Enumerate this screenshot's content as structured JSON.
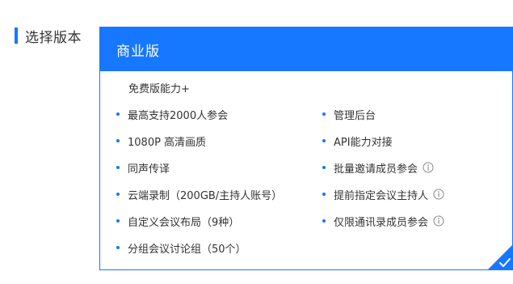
{
  "section": {
    "title": "选择版本"
  },
  "plan": {
    "name": "商业版",
    "subtitle": "免费版能力+",
    "features_left": [
      {
        "label": "最高支持2000人参会",
        "info": false
      },
      {
        "label": "1080P 高清画质",
        "info": false
      },
      {
        "label": "同声传译",
        "info": false
      },
      {
        "label": "云端录制（200GB/主持人账号）",
        "info": false
      },
      {
        "label": "自定义会议布局（9种）",
        "info": false
      },
      {
        "label": "分组会议讨论组（50个）",
        "info": false
      }
    ],
    "features_right": [
      {
        "label": "管理后台",
        "info": false
      },
      {
        "label": "API能力对接",
        "info": false
      },
      {
        "label": "批量邀请成员参会",
        "info": true
      },
      {
        "label": "提前指定会议主持人",
        "info": true
      },
      {
        "label": "仅限通讯录成员参会",
        "info": true
      }
    ],
    "selected": true
  },
  "colors": {
    "accent": "#1677ff",
    "text": "#333333",
    "icon": "#888888"
  },
  "icons": {
    "info": "info-circle-icon",
    "selected": "checkmark-icon"
  }
}
